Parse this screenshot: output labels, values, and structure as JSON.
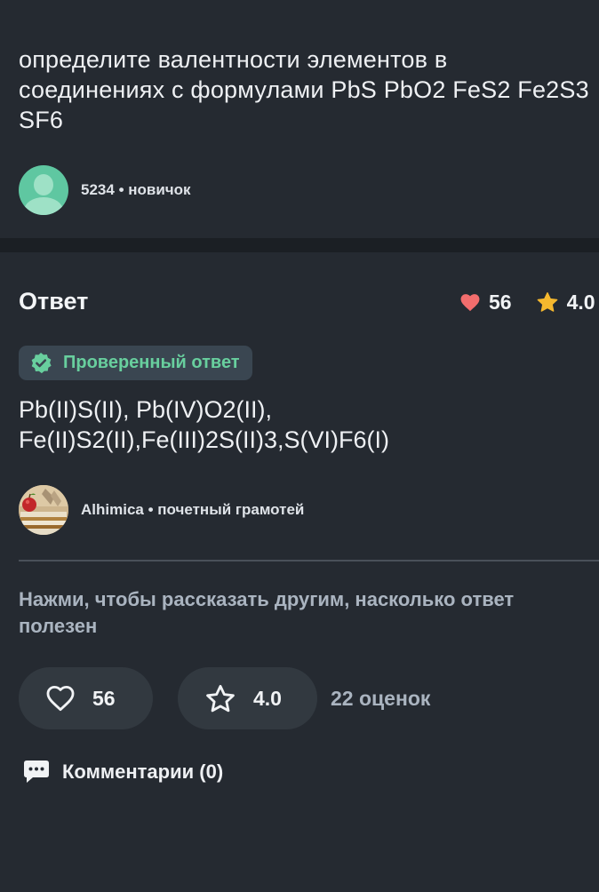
{
  "question": {
    "text": "определите валентности элементов в соединениях с формулами PbS PbO2 FeS2 Fe2S3 SF6",
    "author": {
      "name": "5234",
      "separator": "•",
      "rank": "новичок",
      "avatar": "default-user-avatar"
    }
  },
  "answer": {
    "title": "Ответ",
    "likes": "56",
    "rating": "4.0",
    "verified_label": "Проверенный ответ",
    "text_lines": [
      "Pb(II)S(II), Pb(IV)O2(II),",
      "Fe(II)S2(II),Fe(III)2S(II)3,S(VI)F6(I)"
    ],
    "author": {
      "name": "Alhimica",
      "separator": "•",
      "rank": "почетный грамотей",
      "avatar": "books-and-apple-photo"
    }
  },
  "feedback": {
    "prompt": "Нажми, чтобы рассказать другим, насколько ответ полезен",
    "like_count": "56",
    "rating": "4.0",
    "ratings_count": "22 оценок"
  },
  "comments": {
    "label": "Комментарии (0)",
    "icon": "chat-bubble-icon"
  },
  "colors": {
    "background": "#252a31",
    "divider": "#1b1f24",
    "verified_green": "#68cf9e",
    "heart": "#f26d6d",
    "star": "#f5b82e",
    "muted_text": "#aab4c0"
  }
}
